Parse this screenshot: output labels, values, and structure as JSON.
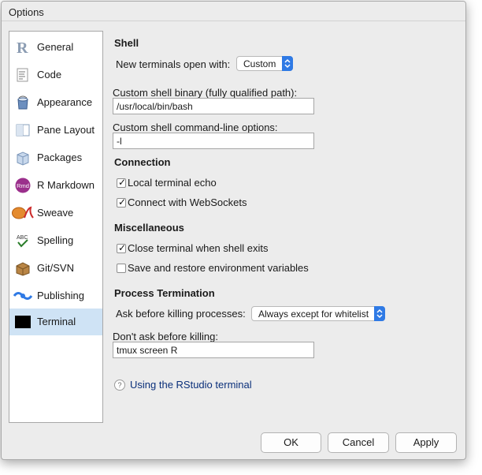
{
  "window": {
    "title": "Options"
  },
  "sidebar": {
    "items": [
      {
        "label": "General",
        "icon": "r-logo-icon",
        "active": false
      },
      {
        "label": "Code",
        "icon": "code-document-icon",
        "active": false
      },
      {
        "label": "Appearance",
        "icon": "paint-bucket-icon",
        "active": false
      },
      {
        "label": "Pane Layout",
        "icon": "pane-layout-icon",
        "active": false
      },
      {
        "label": "Packages",
        "icon": "package-box-icon",
        "active": false
      },
      {
        "label": "R Markdown",
        "icon": "rmd-icon",
        "active": false
      },
      {
        "label": "Sweave",
        "icon": "sweave-pdf-icon",
        "active": false
      },
      {
        "label": "Spelling",
        "icon": "abc-spellcheck-icon",
        "active": false
      },
      {
        "label": "Git/SVN",
        "icon": "git-box-icon",
        "active": false
      },
      {
        "label": "Publishing",
        "icon": "publish-icon",
        "active": false
      },
      {
        "label": "Terminal",
        "icon": "terminal-icon",
        "active": true
      }
    ]
  },
  "shell": {
    "heading": "Shell",
    "new_terminals_label": "New terminals open with:",
    "new_terminals_value": "Custom",
    "binary_label": "Custom shell binary (fully qualified path):",
    "binary_value": "/usr/local/bin/bash",
    "options_label": "Custom shell command-line options:",
    "options_value": "-l"
  },
  "connection": {
    "heading": "Connection",
    "local_echo_label": "Local terminal echo",
    "local_echo_checked": true,
    "websockets_label": "Connect with WebSockets",
    "websockets_checked": true
  },
  "misc": {
    "heading": "Miscellaneous",
    "close_label": "Close terminal when shell exits",
    "close_checked": true,
    "save_env_label": "Save and restore environment variables",
    "save_env_checked": false
  },
  "process": {
    "heading": "Process Termination",
    "ask_label": "Ask before killing processes:",
    "ask_value": "Always except for whitelist",
    "dont_ask_label": "Don't ask before killing:",
    "dont_ask_value": "tmux screen R"
  },
  "help": {
    "icon": "?",
    "link": "Using the RStudio terminal"
  },
  "buttons": {
    "ok": "OK",
    "cancel": "Cancel",
    "apply": "Apply"
  },
  "colors": {
    "accent": "#2f7ae5",
    "selected_bg": "#cfe3f5",
    "link": "#0a2f7a"
  }
}
